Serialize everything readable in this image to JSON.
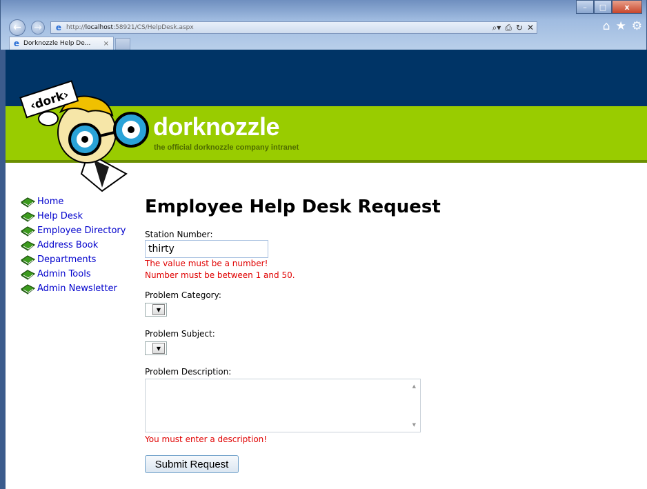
{
  "browser": {
    "url_prefix": "http://",
    "url_host": "localhost",
    "url_rest": ":58921/CS/HelpDesk.aspx",
    "tab_title": "Dorknozzle Help De...",
    "tab_close": "×",
    "window": {
      "minimize": "–",
      "maximize": "□",
      "close": "x"
    },
    "nav": {
      "back": "←",
      "forward": "→"
    },
    "address_icons": [
      "⌕▾",
      "⎙",
      "↻",
      "✕"
    ],
    "tool_icons": {
      "home": "⌂",
      "favorites": "★",
      "settings": "⚙"
    }
  },
  "header": {
    "brand": "dorknozzle",
    "tagline": "the official dorknozzle company intranet",
    "mascot_sign": "‹dork›",
    "colors": {
      "dark": "#003466",
      "green": "#99cc00"
    }
  },
  "sidebar": {
    "items": [
      {
        "label": "Home"
      },
      {
        "label": "Help Desk"
      },
      {
        "label": "Employee Directory"
      },
      {
        "label": "Address Book"
      },
      {
        "label": "Departments"
      },
      {
        "label": "Admin Tools"
      },
      {
        "label": "Admin Newsletter"
      }
    ]
  },
  "form": {
    "title": "Employee Help Desk Request",
    "station_label": "Station Number:",
    "station_value": "thirty",
    "station_errors": [
      "The value must be a number!",
      "Number must be between 1 and 50."
    ],
    "category_label": "Problem Category:",
    "subject_label": "Problem Subject:",
    "description_label": "Problem Description:",
    "description_value": "",
    "description_error": "You must enter a description!",
    "submit_label": "Submit Request",
    "dropdown_arrow": "▼",
    "error_color": "#e00000"
  }
}
